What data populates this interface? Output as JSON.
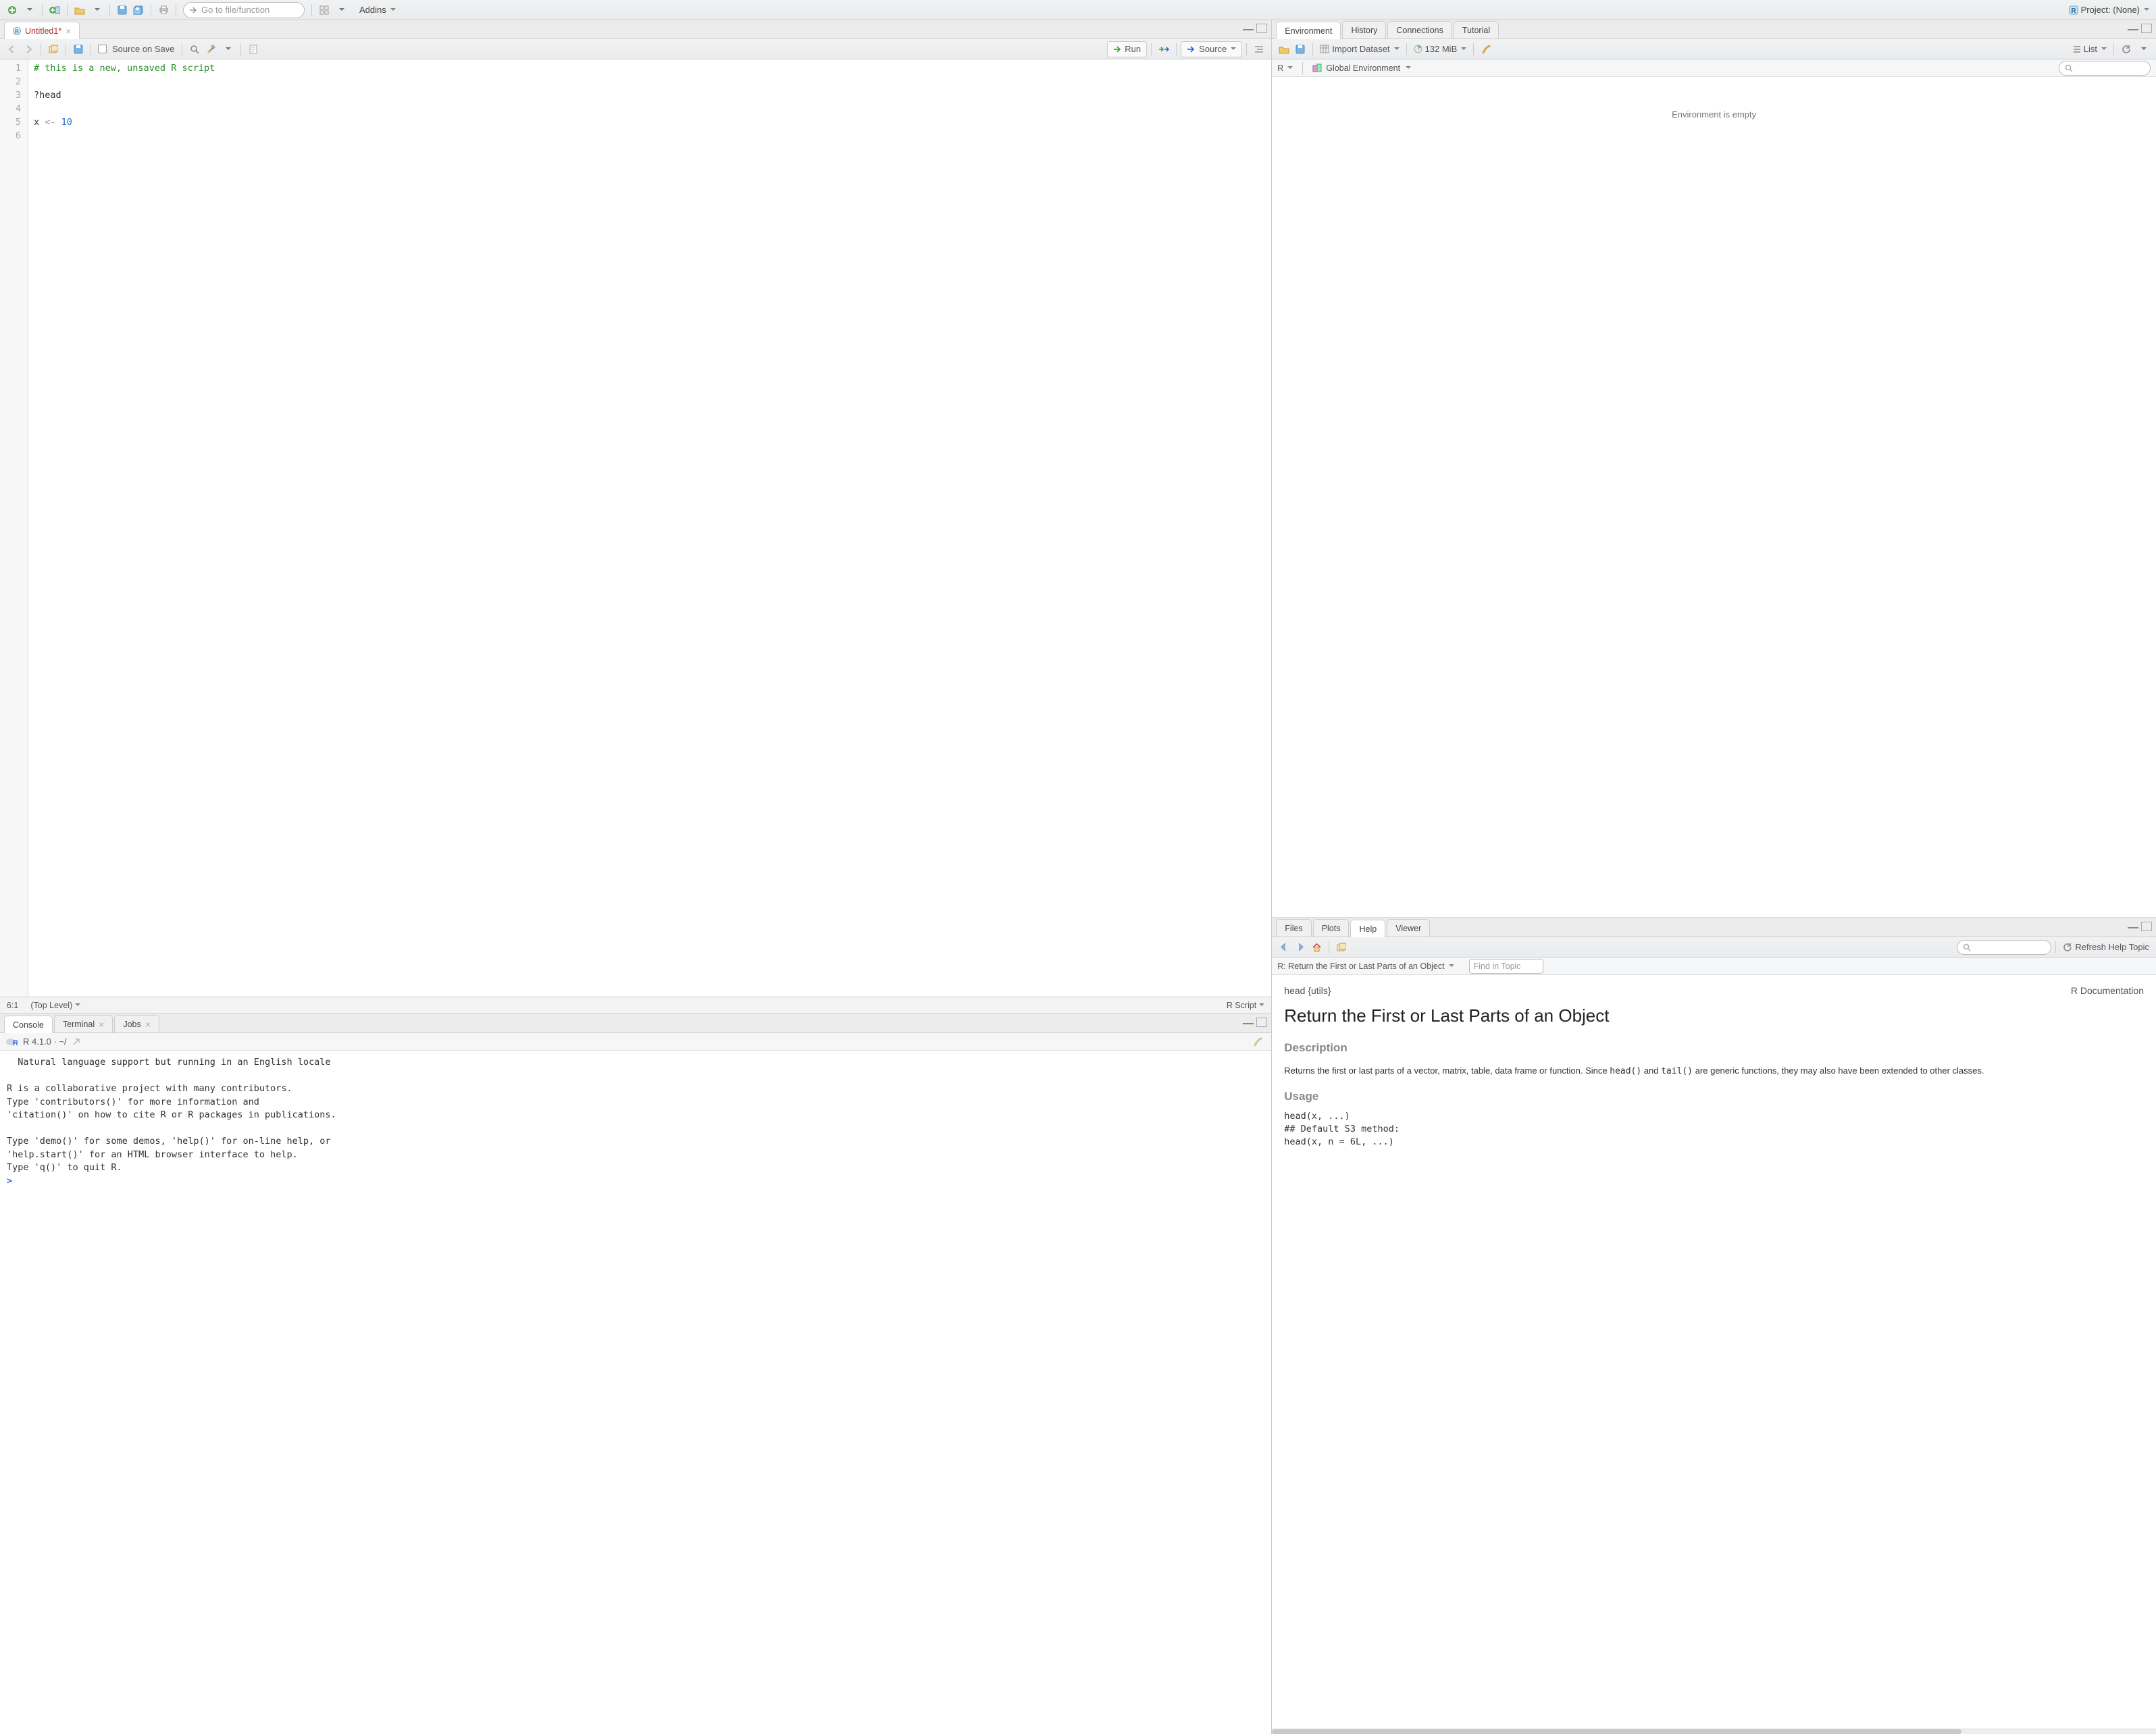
{
  "maintoolbar": {
    "gotofile_placeholder": "Go to file/function",
    "addins_label": "Addins",
    "project_label": "Project: (None)"
  },
  "source": {
    "tab_label": "Untitled1*",
    "source_on_save": "Source on Save",
    "run_label": "Run",
    "source_btn": "Source",
    "gutter": [
      "1",
      "2",
      "3",
      "4",
      "5",
      "6"
    ],
    "code_lines": [
      {
        "type": "comment",
        "text": "# this is a new, unsaved R script"
      },
      {
        "type": "blank",
        "text": ""
      },
      {
        "type": "plain",
        "text": "?head"
      },
      {
        "type": "blank",
        "text": ""
      },
      {
        "type": "assign",
        "var": "x",
        "op": "<-",
        "val": "10"
      },
      {
        "type": "blank",
        "text": ""
      }
    ],
    "status_pos": "6:1",
    "status_scope": "(Top Level)",
    "status_lang": "R Script"
  },
  "console": {
    "tabs": [
      "Console",
      "Terminal",
      "Jobs"
    ],
    "active_tab": 0,
    "version_line": "R 4.1.0 · ~/",
    "body_lines": [
      "  Natural language support but running in an English locale",
      "",
      "R is a collaborative project with many contributors.",
      "Type 'contributors()' for more information and",
      "'citation()' on how to cite R or R packages in publications.",
      "",
      "Type 'demo()' for some demos, 'help()' for on-line help, or",
      "'help.start()' for an HTML browser interface to help.",
      "Type 'q()' to quit R.",
      ""
    ],
    "prompt": ">"
  },
  "env": {
    "tabs": [
      "Environment",
      "History",
      "Connections",
      "Tutorial"
    ],
    "active_tab": 0,
    "import_label": "Import Dataset",
    "mem_label": "132 MiB",
    "view_label": "List",
    "scope_lang": "R",
    "scope_env": "Global Environment",
    "empty_msg": "Environment is empty"
  },
  "help": {
    "tabs": [
      "Files",
      "Plots",
      "Help",
      "Viewer"
    ],
    "active_tab": 2,
    "refresh_label": "Refresh Help Topic",
    "breadcrumb": "R: Return the First or Last Parts of an Object",
    "find_placeholder": "Find in Topic",
    "doc": {
      "topic": "head {utils}",
      "docset": "R Documentation",
      "title": "Return the First or Last Parts of an Object",
      "desc_h": "Description",
      "desc_body_1": "Returns the first or last parts of a vector, matrix, table, data frame or function. Since ",
      "desc_code_1": "head()",
      "desc_body_2": " and ",
      "desc_code_2": "tail()",
      "desc_body_3": " are generic functions, they may also have been extended to other classes.",
      "usage_h": "Usage",
      "usage_lines": [
        "head(x, ...)",
        "## Default S3 method:",
        "head(x, n = 6L, ...)"
      ]
    }
  }
}
